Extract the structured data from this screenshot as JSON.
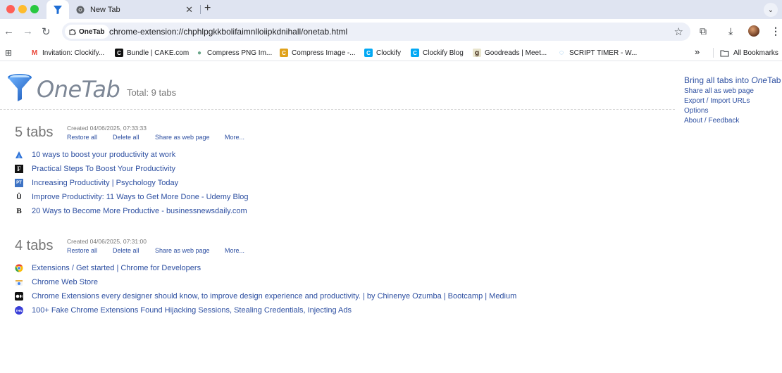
{
  "browser": {
    "tabs": [
      {
        "title": "",
        "icon": "onetab-funnel-icon",
        "active": true
      },
      {
        "title": "New Tab",
        "icon": "chrome-icon",
        "active": false
      }
    ],
    "new_tab_symbol": "+",
    "close_symbol": "✕",
    "tab_menu_symbol": "⌄",
    "url": "chrome-extension://chphlpgkkbolifaimnlloiipkdnihall/onetab.html",
    "site_chip": "OneTab",
    "bookmarks": [
      {
        "label": "Invitation: Clockify...",
        "icon": "gmail-icon",
        "color": "#ea4335",
        "glyph": "M"
      },
      {
        "label": "Bundle | CAKE.com",
        "icon": "cake-icon",
        "color": "#111111",
        "glyph": "C"
      },
      {
        "label": "Compress PNG Im...",
        "icon": "panda-icon",
        "color": "#6aa68a",
        "glyph": "●"
      },
      {
        "label": "Compress Image -...",
        "icon": "compress-image-icon",
        "color": "#e0a21b",
        "glyph": "C"
      },
      {
        "label": "Clockify",
        "icon": "clockify-icon",
        "color": "#03a9f4",
        "glyph": "C"
      },
      {
        "label": "Clockify Blog",
        "icon": "clockify-blog-icon",
        "color": "#03a9f4",
        "glyph": "C"
      },
      {
        "label": "Goodreads | Meet...",
        "icon": "goodreads-icon",
        "color": "#e9e5cd",
        "glyph": "g"
      },
      {
        "label": "SCRIPT TIMER - W...",
        "icon": "timer-icon",
        "color": "#6fb4e8",
        "glyph": "◌"
      }
    ],
    "bookmarks_overflow": "»",
    "all_bookmarks": "All Bookmarks"
  },
  "onetab": {
    "logo_text": "OneTab",
    "total": "Total: 9 tabs",
    "side_actions": {
      "bring_all_prefix": "Bring all tabs into ",
      "bring_all_em": "One",
      "bring_all_suffix": "Tab",
      "links": [
        "Share all as web page",
        "Export / Import URLs",
        "Options",
        "About / Feedback"
      ]
    },
    "groups": [
      {
        "count": "5 tabs",
        "created": "Created 04/06/2025, 07:33:33",
        "actions": [
          "Restore all",
          "Delete all",
          "Share as web page",
          "More..."
        ],
        "tabs": [
          {
            "title": "10 ways to boost your productivity at work",
            "icon": "atlassian-icon",
            "color": "#2b6fd6",
            "glyph": "▲"
          },
          {
            "title": "Practical Steps To Boost Your Productivity",
            "icon": "forbes-icon",
            "color": "#111111",
            "glyph": "F"
          },
          {
            "title": "Increasing Productivity | Psychology Today",
            "icon": "psychology-today-icon",
            "color": "#3d73c4",
            "glyph": "PT"
          },
          {
            "title": "Improve Productivity: 11 Ways to Get More Done - Udemy Blog",
            "icon": "udemy-icon",
            "color": "#1c1d1f",
            "glyph": "Û"
          },
          {
            "title": "20 Ways to Become More Productive - businessnewsdaily.com",
            "icon": "bnd-icon",
            "color": "#111111",
            "glyph": "B"
          }
        ]
      },
      {
        "count": "4 tabs",
        "created": "Created 04/06/2025, 07:31:00",
        "actions": [
          "Restore all",
          "Delete all",
          "Share as web page",
          "More..."
        ],
        "tabs": [
          {
            "title": "Extensions / Get started  |  Chrome for Developers",
            "icon": "chrome-icon",
            "color": "#4285f4",
            "glyph": "◉"
          },
          {
            "title": "Chrome Web Store",
            "icon": "web-store-icon",
            "color": "#e8b04a",
            "glyph": "▰"
          },
          {
            "title": "Chrome Extensions every designer should know, to improve design experience and productivity. | by Chinenye Ozumba | Bootcamp | Medium",
            "icon": "medium-icon",
            "color": "#111111",
            "glyph": "●●"
          },
          {
            "title": "100+ Fake Chrome Extensions Found Hijacking Sessions, Stealing Credentials, Injecting Ads",
            "icon": "hackernews-icon",
            "color": "#3a3fd8",
            "glyph": "THN"
          }
        ]
      }
    ]
  },
  "colors": {
    "link": "#2d4fa1",
    "funnel": "#1f6ed4",
    "tabbar": "#dfe4f1"
  }
}
